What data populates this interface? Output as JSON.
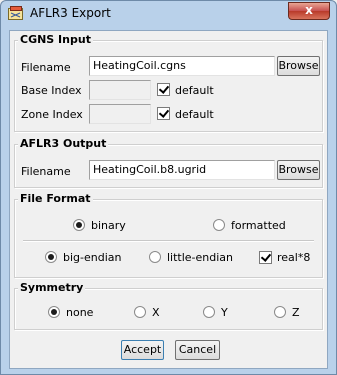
{
  "window": {
    "title": "AFLR3 Export",
    "close_glyph": "x"
  },
  "cgns_input": {
    "legend": "CGNS Input",
    "filename_label": "Filename",
    "filename_value": "HeatingCoil.cgns",
    "browse_label": "Browse",
    "base_index_label": "Base Index",
    "base_index_value": "",
    "base_default_label": "default",
    "base_default_checked": true,
    "zone_index_label": "Zone Index",
    "zone_index_value": "",
    "zone_default_label": "default",
    "zone_default_checked": true
  },
  "aflr3_output": {
    "legend": "AFLR3 Output",
    "filename_label": "Filename",
    "filename_value": "HeatingCoil.b8.ugrid",
    "browse_label": "Browse"
  },
  "file_format": {
    "legend": "File Format",
    "type_options": [
      "binary",
      "formatted"
    ],
    "type_selected": "binary",
    "endian_options": [
      "big-endian",
      "little-endian"
    ],
    "endian_selected": "big-endian",
    "real8_label": "real*8",
    "real8_checked": true
  },
  "symmetry": {
    "legend": "Symmetry",
    "options": [
      "none",
      "X",
      "Y",
      "Z"
    ],
    "selected": "none"
  },
  "actions": {
    "accept_label": "Accept",
    "cancel_label": "Cancel"
  },
  "icons": {
    "app": "app-icon",
    "close": "close-icon"
  }
}
